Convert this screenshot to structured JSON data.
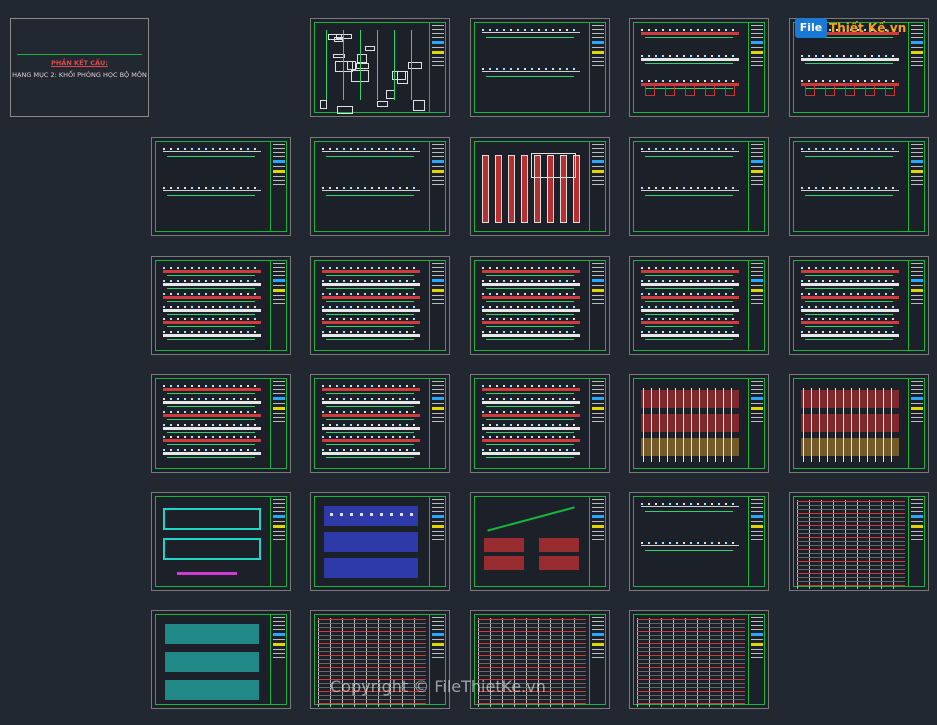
{
  "cover": {
    "heading": "PHẦN KẾT CẤU:",
    "subheading": "HẠNG MỤC 2: KHỐI PHÒNG HỌC BỘ MÔN"
  },
  "logo": {
    "mark": "File",
    "name": "Thiết Kế.vn"
  },
  "watermark": "Copyright © FileThietKe.vn",
  "sheets": [
    {
      "name": "sheet-1-1",
      "style": "details"
    },
    {
      "name": "sheet-1-2",
      "style": "grid-plan"
    },
    {
      "name": "sheet-1-3",
      "style": "red-beams"
    },
    {
      "name": "sheet-1-4",
      "style": "red-beams"
    },
    {
      "name": "sheet-2-1",
      "style": "grid-plan"
    },
    {
      "name": "sheet-2-2",
      "style": "grid-plan"
    },
    {
      "name": "sheet-2-3",
      "style": "columns"
    },
    {
      "name": "sheet-2-4",
      "style": "grid-plan"
    },
    {
      "name": "sheet-2-5",
      "style": "grid-plan"
    },
    {
      "name": "sheet-3-1",
      "style": "beam-elev"
    },
    {
      "name": "sheet-3-2",
      "style": "beam-elev"
    },
    {
      "name": "sheet-3-3",
      "style": "beam-elev"
    },
    {
      "name": "sheet-3-4",
      "style": "beam-elev"
    },
    {
      "name": "sheet-3-5",
      "style": "beam-elev"
    },
    {
      "name": "sheet-4-1",
      "style": "beam-elev"
    },
    {
      "name": "sheet-4-2",
      "style": "beam-elev"
    },
    {
      "name": "sheet-4-3",
      "style": "beam-elev"
    },
    {
      "name": "sheet-4-4",
      "style": "slab-red"
    },
    {
      "name": "sheet-4-5",
      "style": "slab-red"
    },
    {
      "name": "sheet-5-1",
      "style": "cyan-plan"
    },
    {
      "name": "sheet-5-2",
      "style": "blue-plan"
    },
    {
      "name": "sheet-5-3",
      "style": "stairs"
    },
    {
      "name": "sheet-5-4",
      "style": "grid-plan"
    },
    {
      "name": "sheet-5-5",
      "style": "table"
    },
    {
      "name": "sheet-6-1",
      "style": "cyan-roof"
    },
    {
      "name": "sheet-6-2",
      "style": "table"
    },
    {
      "name": "sheet-6-3",
      "style": "table"
    },
    {
      "name": "sheet-6-4",
      "style": "table"
    }
  ]
}
